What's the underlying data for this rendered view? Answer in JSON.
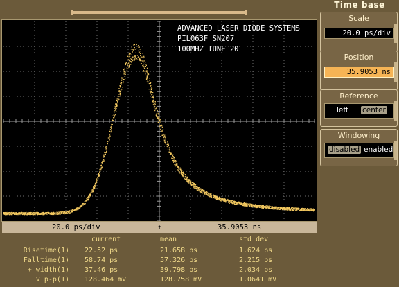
{
  "title": {
    "line1": "ADVANCED LASER DIODE SYSTEMS",
    "line2": "PIL063F SN207",
    "line3": "100MHZ TUNE 20"
  },
  "scale_bar": {
    "scale": "20.0 ps/div",
    "marker": "↑",
    "position": "35.9053 ns"
  },
  "measurements": {
    "headers": {
      "current": "current",
      "mean": "mean",
      "std_dev": "std dev"
    },
    "rows": [
      {
        "name": "Risetime(1)",
        "current": "22.52 ps",
        "mean": "21.658 ps",
        "std_dev": "1.624 ps"
      },
      {
        "name": "Falltime(1)",
        "current": "58.74 ps",
        "mean": "57.326 ps",
        "std_dev": "2.215 ps"
      },
      {
        "name": "+ width(1)",
        "current": "37.46 ps",
        "mean": "39.798 ps",
        "std_dev": "2.034 ps"
      },
      {
        "name": "V p-p(1)",
        "current": "128.464 mV",
        "mean": "128.758 mV",
        "std_dev": "1.0641 mV"
      }
    ]
  },
  "panel": {
    "title": "Time base",
    "scale": {
      "label": "Scale",
      "value": "20.0 ps/div"
    },
    "position": {
      "label": "Position",
      "value": "35.9053 ns"
    },
    "reference": {
      "label": "Reference",
      "left": "left",
      "center": "center",
      "selected": "center"
    },
    "windowing": {
      "label": "Windowing",
      "disabled": "disabled",
      "enabled": "enabled",
      "selected": "disabled"
    }
  },
  "colors": {
    "trace": "#f3c960",
    "grid": "#6e6e6e",
    "background": "#6b5a3a",
    "accent": "#f6b455"
  },
  "waveform": {
    "baseline_level": 0.04,
    "peak_level": 0.85,
    "peak_x_div": 4.25,
    "risetime_ps": 22.52,
    "falltime_ps": 58.74
  }
}
